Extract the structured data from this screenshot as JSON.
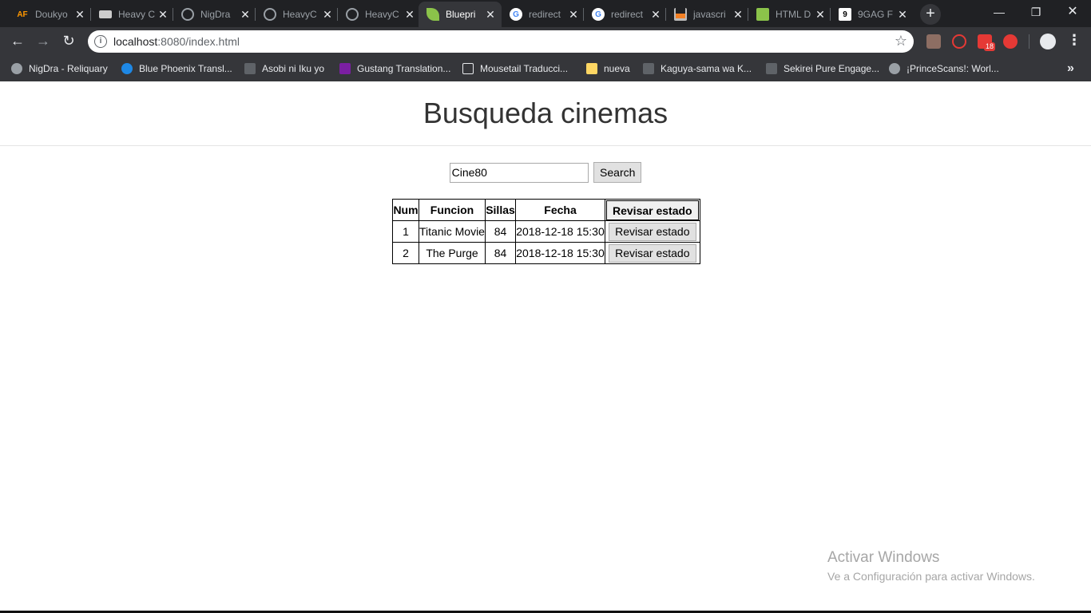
{
  "browser": {
    "tabs": [
      {
        "title": "Doukyo",
        "favicon": "AF",
        "favicon_color": "#ff9800",
        "active": false
      },
      {
        "title": "Heavy C",
        "favicon": "",
        "favicon_color": "#cccccc",
        "active": false
      },
      {
        "title": "NigDra",
        "favicon": "",
        "favicon_color": "#9aa0a6",
        "active": false
      },
      {
        "title": "HeavyC",
        "favicon": "",
        "favicon_color": "#9aa0a6",
        "active": false
      },
      {
        "title": "HeavyC",
        "favicon": "",
        "favicon_color": "#9aa0a6",
        "active": false
      },
      {
        "title": "Bluepri",
        "favicon": "",
        "favicon_color": "#8bc34a",
        "active": true
      },
      {
        "title": "redirect",
        "favicon": "G",
        "favicon_color": "#4285f4",
        "active": false
      },
      {
        "title": "redirect",
        "favicon": "G",
        "favicon_color": "#4285f4",
        "active": false
      },
      {
        "title": "javascri",
        "favicon": "",
        "favicon_color": "#f48024",
        "active": false
      },
      {
        "title": "HTML D",
        "favicon": "",
        "favicon_color": "#8bc34a",
        "active": false
      },
      {
        "title": "9GAG F",
        "favicon": "9",
        "favicon_color": "#ffffff",
        "active": false
      }
    ],
    "close_glyph": "✕",
    "new_tab_glyph": "+",
    "window_controls": {
      "minimize": "—",
      "maximize": "❐",
      "close": "✕"
    },
    "nav": {
      "back": "←",
      "forward": "→",
      "reload": "↻"
    },
    "url": {
      "host": "localhost",
      "path": ":8080/index.html"
    },
    "bookmarks": [
      {
        "label": "NigDra - Reliquary",
        "icon_color": "#9aa0a6"
      },
      {
        "label": "Blue Phoenix Transl...",
        "icon_color": "#1e88e5"
      },
      {
        "label": "Asobi ni Iku yo",
        "icon_color": "#5f6368"
      },
      {
        "label": "Gustang Translation...",
        "icon_color": "#7b1fa2"
      },
      {
        "label": "Mousetail Traducci...",
        "icon_color": "#e8eaed"
      },
      {
        "label": "nueva",
        "icon_color": "#fdd663"
      },
      {
        "label": "Kaguya-sama wa K...",
        "icon_color": "#5f6368"
      },
      {
        "label": "Sekirei Pure Engage...",
        "icon_color": "#5f6368"
      },
      {
        "label": "¡PrinceScans!: Worl...",
        "icon_color": "#9aa0a6"
      }
    ],
    "bookmarks_more": "»",
    "extension_badge": "18"
  },
  "page": {
    "title": "Busqueda cinemas",
    "search": {
      "value": "Cine80",
      "button_label": "Search"
    },
    "table": {
      "headers": [
        "Num",
        "Funcion",
        "Sillas",
        "Fecha",
        "Revisar estado"
      ],
      "rows": [
        {
          "num": "1",
          "funcion": "Titanic Movie",
          "sillas": "84",
          "fecha": "2018-12-18 15:30",
          "action": "Revisar estado"
        },
        {
          "num": "2",
          "funcion": "The Purge",
          "sillas": "84",
          "fecha": "2018-12-18 15:30",
          "action": "Revisar estado"
        }
      ]
    }
  },
  "watermark": {
    "line1": "Activar Windows",
    "line2": "Ve a Configuración para activar Windows."
  }
}
